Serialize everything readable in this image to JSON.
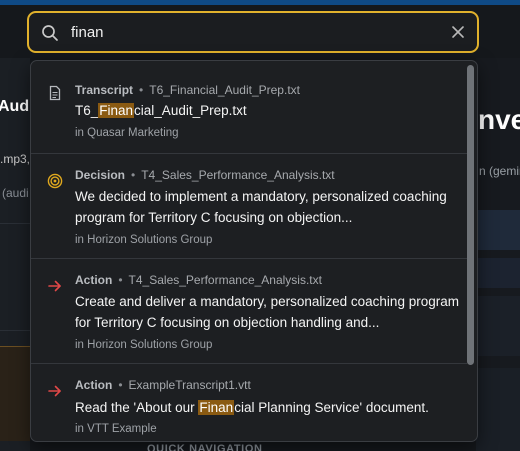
{
  "search": {
    "value": "finan",
    "placeholder": ""
  },
  "background": {
    "left_title": "Audi",
    "left_file": ".mp3,",
    "left_meta": "(audi",
    "right_title": "nve",
    "right_meta": "n (gemin",
    "bottom_nav": "QUICK NAVIGATION"
  },
  "results": [
    {
      "kind": "Transcript",
      "file": "T6_Financial_Audit_Prep.txt",
      "title_pre": "T6_",
      "title_hl": "Finan",
      "title_post": "cial_Audit_Prep.txt",
      "org": "in Quasar Marketing",
      "icon": "document-icon"
    },
    {
      "kind": "Decision",
      "file": "T4_Sales_Performance_Analysis.txt",
      "title": "We decided to implement a mandatory, personalized coaching program for Territory C focusing on objection...",
      "org": "in Horizon Solutions Group",
      "icon": "target-icon"
    },
    {
      "kind": "Action",
      "file": "T4_Sales_Performance_Analysis.txt",
      "title": "Create and deliver a mandatory, personalized coaching program for Territory C focusing on objection handling and...",
      "org": "in Horizon Solutions Group",
      "icon": "arrow-right-icon"
    },
    {
      "kind": "Action",
      "file": "ExampleTranscript1.vtt",
      "title_pre": "Read the 'About our ",
      "title_hl": "Finan",
      "title_post": "cial Planning Service' document.",
      "org": "in VTT Example",
      "icon": "arrow-right-icon"
    }
  ],
  "colors": {
    "accent_border": "#e1b12c",
    "highlight": "#8a5a12",
    "decision_icon": "#e1a91e",
    "action_icon": "#e04848"
  }
}
